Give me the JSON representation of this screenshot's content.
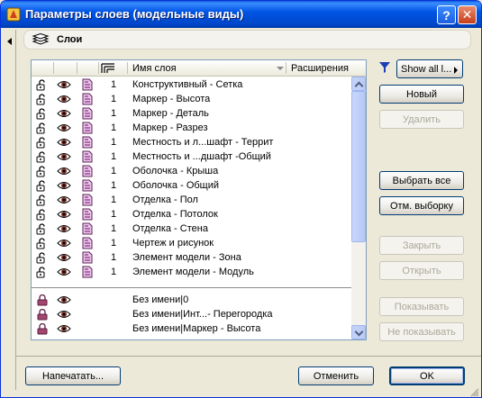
{
  "window": {
    "title": "Параметры слоев (модельные виды)",
    "help_label": "?",
    "close_label": "✕"
  },
  "header": {
    "label": "Слои"
  },
  "list": {
    "columns": {
      "name": "Имя слоя",
      "extension": "Расширения"
    },
    "rows": [
      {
        "lock": "open",
        "num": "1",
        "name": "Конструктивный - Сетка"
      },
      {
        "lock": "open",
        "num": "1",
        "name": "Маркер - Высота"
      },
      {
        "lock": "open",
        "num": "1",
        "name": "Маркер - Деталь"
      },
      {
        "lock": "open",
        "num": "1",
        "name": "Маркер - Разрез"
      },
      {
        "lock": "open",
        "num": "1",
        "name": "Местность и л...шафт - Террит"
      },
      {
        "lock": "open",
        "num": "1",
        "name": "Местность и ...дшафт -Общий"
      },
      {
        "lock": "open",
        "num": "1",
        "name": "Оболочка - Крыша"
      },
      {
        "lock": "open",
        "num": "1",
        "name": "Оболочка - Общий"
      },
      {
        "lock": "open",
        "num": "1",
        "name": "Отделка - Пол"
      },
      {
        "lock": "open",
        "num": "1",
        "name": "Отделка - Потолок"
      },
      {
        "lock": "open",
        "num": "1",
        "name": "Отделка - Стена"
      },
      {
        "lock": "open",
        "num": "1",
        "name": "Чертеж и рисунок"
      },
      {
        "lock": "open",
        "num": "1",
        "name": "Элемент модели - Зона"
      },
      {
        "lock": "open",
        "num": "1",
        "name": "Элемент модели - Модуль"
      }
    ],
    "special_rows": [
      {
        "lock": "closed",
        "name": "Без имени|0"
      },
      {
        "lock": "closed",
        "name": "Без имени|Инт...- Перегородка"
      },
      {
        "lock": "closed",
        "name": "Без имени|Маркер - Высота"
      }
    ]
  },
  "side_buttons": {
    "show_all": "Show all l...",
    "new": "Новый",
    "delete": "Удалить",
    "select_all": "Выбрать все",
    "deselect": "Отм. выборку",
    "close": "Закрыть",
    "open": "Открыть",
    "show": "Показывать",
    "hide": "Не показывать"
  },
  "footer": {
    "print": "Напечатать...",
    "cancel": "Отменить",
    "ok": "OK"
  },
  "colors": {
    "titlebar": "#0055e5",
    "close": "#c63e1c",
    "accent_lock": "#8b2b5a",
    "page_icon": "#a0308a"
  }
}
